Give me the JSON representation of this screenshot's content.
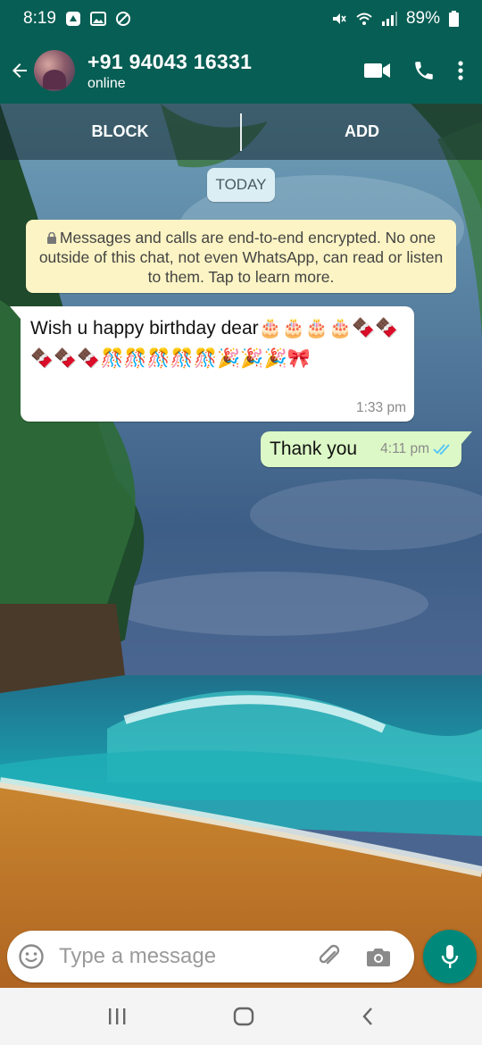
{
  "status_bar": {
    "time": "8:19",
    "battery": "89%"
  },
  "header": {
    "contact_name": "+91 94043 16331",
    "status": "online"
  },
  "action_bar": {
    "block_label": "BLOCK",
    "add_label": "ADD"
  },
  "chat": {
    "date_chip": "TODAY",
    "encryption_notice": "Messages and calls are end-to-end encrypted. No one outside of this chat, not even WhatsApp, can read or listen to them. Tap to learn more.",
    "messages": [
      {
        "direction": "incoming",
        "text": "Wish u happy birthday dear🎂🎂🎂🎂🍫🍫🍫🍫🍫🎊🎊🎊🎊🎊🎉🎉🎉🎀",
        "time": "1:33 pm"
      },
      {
        "direction": "outgoing",
        "text": "Thank you",
        "time": "4:11 pm",
        "read_status": "read"
      }
    ]
  },
  "composer": {
    "placeholder": "Type a message"
  },
  "colors": {
    "header": "#075e54",
    "accent": "#00897b",
    "outgoing_bubble": "#dcf8c6",
    "read_ticks": "#4fc3f7"
  }
}
